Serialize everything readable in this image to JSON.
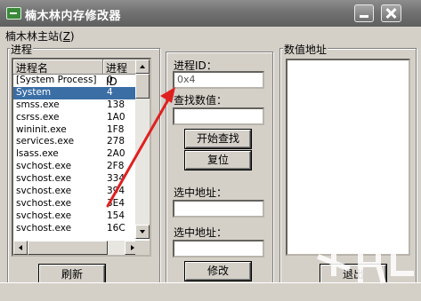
{
  "window": {
    "title": "楠木林内存修改器"
  },
  "menu": {
    "items": [
      {
        "label_main": "楠木林主站(",
        "label_accel": "Z",
        "label_end": ")"
      }
    ]
  },
  "process_group": {
    "label": "进程",
    "columns": {
      "name": "进程名",
      "pid": "进程ID"
    },
    "rows": [
      {
        "name": "[System Process]",
        "pid": "0"
      },
      {
        "name": "System",
        "pid": "4"
      },
      {
        "name": "smss.exe",
        "pid": "138"
      },
      {
        "name": "csrss.exe",
        "pid": "1A0"
      },
      {
        "name": "wininit.exe",
        "pid": "1F8"
      },
      {
        "name": "services.exe",
        "pid": "278"
      },
      {
        "name": "lsass.exe",
        "pid": "2A0"
      },
      {
        "name": "svchost.exe",
        "pid": "2F8"
      },
      {
        "name": "svchost.exe",
        "pid": "334"
      },
      {
        "name": "svchost.exe",
        "pid": "394"
      },
      {
        "name": "svchost.exe",
        "pid": "3E4"
      },
      {
        "name": "svchost.exe",
        "pid": "154"
      },
      {
        "name": "svchost.exe",
        "pid": "16C"
      },
      {
        "name": "",
        "pid": ""
      }
    ],
    "selected_index": 1,
    "refresh_button": "刷新"
  },
  "search_panel": {
    "pid_label": "进程ID：",
    "pid_value": "0x4",
    "search_value_label": "查找数值：",
    "search_value": "",
    "start_search_button": "开始查找",
    "reset_button": "复位",
    "selected_addr_label_1": "选中地址：",
    "selected_addr_value_1": "",
    "selected_addr_label_2": "选中地址：",
    "selected_addr_value_2": "",
    "modify_button": "修改"
  },
  "address_group": {
    "label": "数值地址",
    "exit_button": "退出"
  },
  "colors": {
    "selection": "#3a6ea5",
    "arrow": "#e02020",
    "face": "#d4d0c8"
  }
}
